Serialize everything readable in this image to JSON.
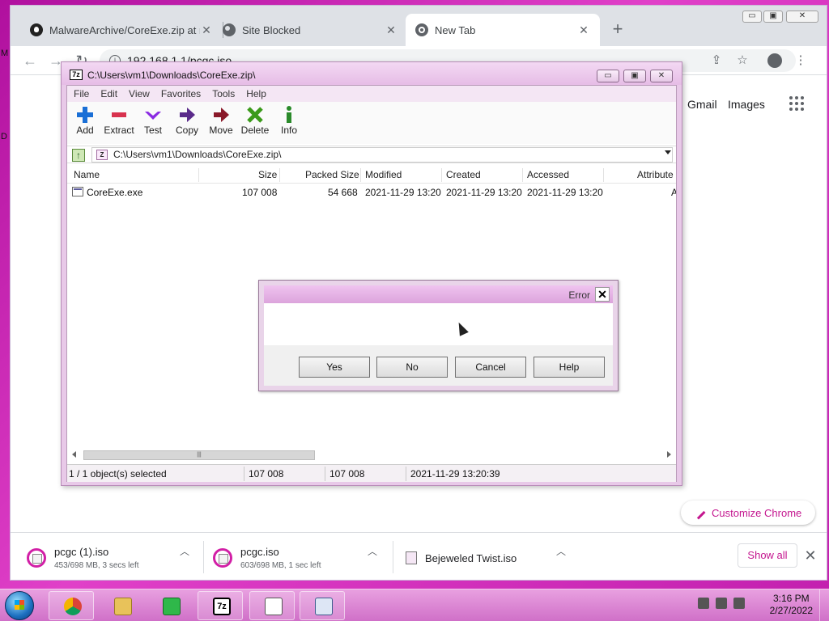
{
  "chrome": {
    "tabs": [
      {
        "title": "MalwareArchive/CoreExe.zip at m",
        "icon": "github-icon"
      },
      {
        "title": "Site Blocked",
        "icon": "globe-icon"
      },
      {
        "title": "New Tab",
        "icon": "chrome-icon"
      }
    ],
    "new_tab_symbol": "+",
    "window_controls": {
      "minimize": "▭",
      "maximize": "▣",
      "close": "✕"
    },
    "url": "192.168.1.1/pcgc.iso",
    "header_links": {
      "gmail": "Gmail",
      "images": "Images"
    },
    "customize_label": "Customize Chrome",
    "downloads": [
      {
        "name": "pcgc (1).iso",
        "status": "453/698 MB, 3 secs left"
      },
      {
        "name": "pcgc.iso",
        "status": "603/698 MB, 1 sec left"
      },
      {
        "name": "Bejeweled Twist.iso",
        "status": ""
      }
    ],
    "show_all_label": "Show all"
  },
  "zip": {
    "title": "C:\\Users\\vm1\\Downloads\\CoreExe.zip\\",
    "logo_text": "7z",
    "menu": [
      "File",
      "Edit",
      "View",
      "Favorites",
      "Tools",
      "Help"
    ],
    "toolbar": [
      {
        "label": "Add",
        "icon": "plus-icon",
        "color": "#1a6fd6"
      },
      {
        "label": "Extract",
        "icon": "minus-icon",
        "color": "#d8324e"
      },
      {
        "label": "Test",
        "icon": "check-icon",
        "color": "#8a2be2"
      },
      {
        "label": "Copy",
        "icon": "arrow-right-icon",
        "color": "#5a2a8a"
      },
      {
        "label": "Move",
        "icon": "arrow-right-icon",
        "color": "#8a1a2a"
      },
      {
        "label": "Delete",
        "icon": "x-icon",
        "color": "#3a9a1a"
      },
      {
        "label": "Info",
        "icon": "info-icon",
        "color": "#2a8a2a"
      }
    ],
    "path": "C:\\Users\\vm1\\Downloads\\CoreExe.zip\\",
    "columns": [
      "Name",
      "Size",
      "Packed Size",
      "Modified",
      "Created",
      "Accessed",
      "Attribute"
    ],
    "rows": [
      {
        "name": "CoreExe.exe",
        "size": "107 008",
        "packed": "54 668",
        "modified": "2021-11-29 13:20",
        "created": "2021-11-29 13:20",
        "accessed": "2021-11-29 13:20",
        "attr": "A"
      }
    ],
    "status": {
      "selected": "1 / 1 object(s) selected",
      "size": "107 008",
      "packed": "107 008",
      "date": "2021-11-29 13:20:39"
    }
  },
  "error_dialog": {
    "title": "Error",
    "close_symbol": "✕",
    "buttons": [
      "Yes",
      "No",
      "Cancel",
      "Help"
    ]
  },
  "taskbar": {
    "time": "3:16 PM",
    "date": "2/27/2022",
    "apps": [
      "chrome",
      "file-explorer",
      "media-player",
      "7-zip",
      "notepad",
      "window"
    ]
  },
  "desktop_edge_letters": [
    "M",
    "D"
  ]
}
